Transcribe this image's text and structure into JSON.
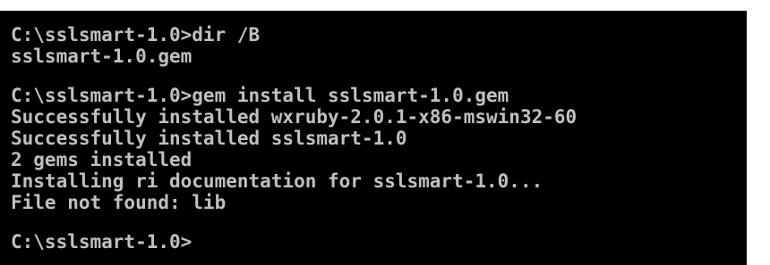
{
  "console": {
    "lines": [
      "C:\\sslsmart-1.0>dir /B",
      "sslsmart-1.0.gem",
      "",
      "C:\\sslsmart-1.0>gem install sslsmart-1.0.gem",
      "Successfully installed wxruby-2.0.1-x86-mswin32-60",
      "Successfully installed sslsmart-1.0",
      "2 gems installed",
      "Installing ri documentation for sslsmart-1.0...",
      "File not found: lib",
      "",
      "C:\\sslsmart-1.0>"
    ],
    "colors": {
      "background": "#000000",
      "text": "#c0c0c0"
    }
  }
}
